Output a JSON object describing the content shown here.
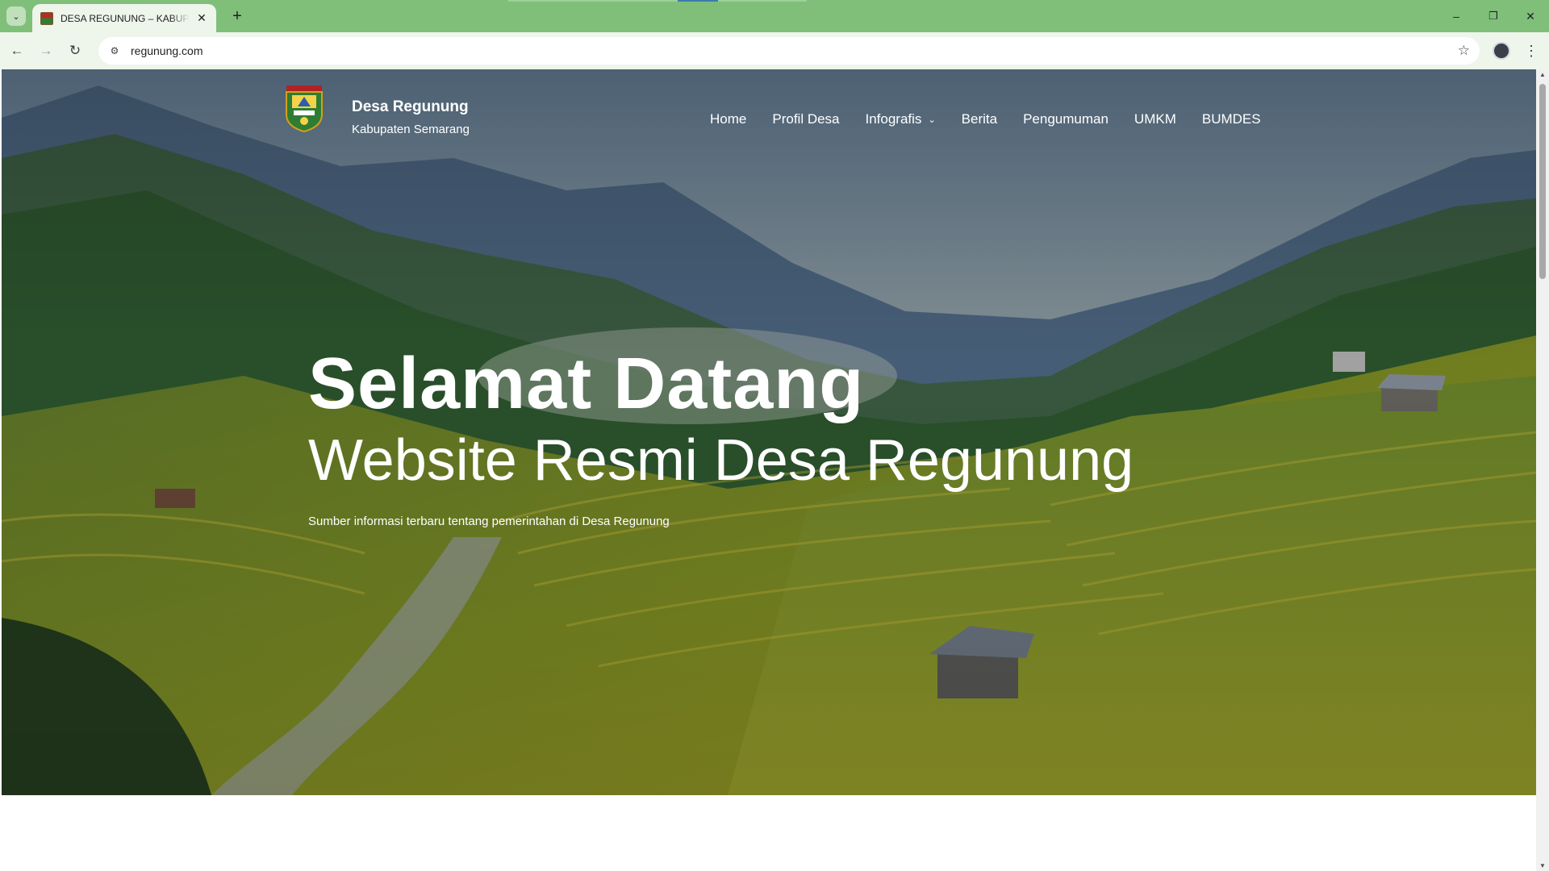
{
  "browser": {
    "tab_title": "DESA REGUNUNG – KABUPATEN SEMARANG",
    "url": "regunung.com",
    "tab_search_icon": "chevron-down-icon",
    "new_tab_label": "+",
    "minimize": "–",
    "restore": "❐",
    "close": "✕",
    "back": "←",
    "forward": "→",
    "reload": "↻",
    "site_info_icon": "⚙",
    "bookmark": "☆",
    "menu": "⋮",
    "accent_color": "#7fbf7a"
  },
  "site": {
    "name": "Desa Regunung",
    "subtitle": "Kabupaten Semarang",
    "nav": [
      {
        "label": "Home"
      },
      {
        "label": "Profil Desa"
      },
      {
        "label": "Infografis",
        "dropdown": true
      },
      {
        "label": "Berita"
      },
      {
        "label": "Pengumuman"
      },
      {
        "label": "UMKM"
      },
      {
        "label": "BUMDES"
      }
    ]
  },
  "hero": {
    "heading": "Selamat Datang",
    "subheading": "Website Resmi Desa Regunung",
    "description": "Sumber informasi terbaru tentang pemerintahan di Desa Regunung"
  }
}
